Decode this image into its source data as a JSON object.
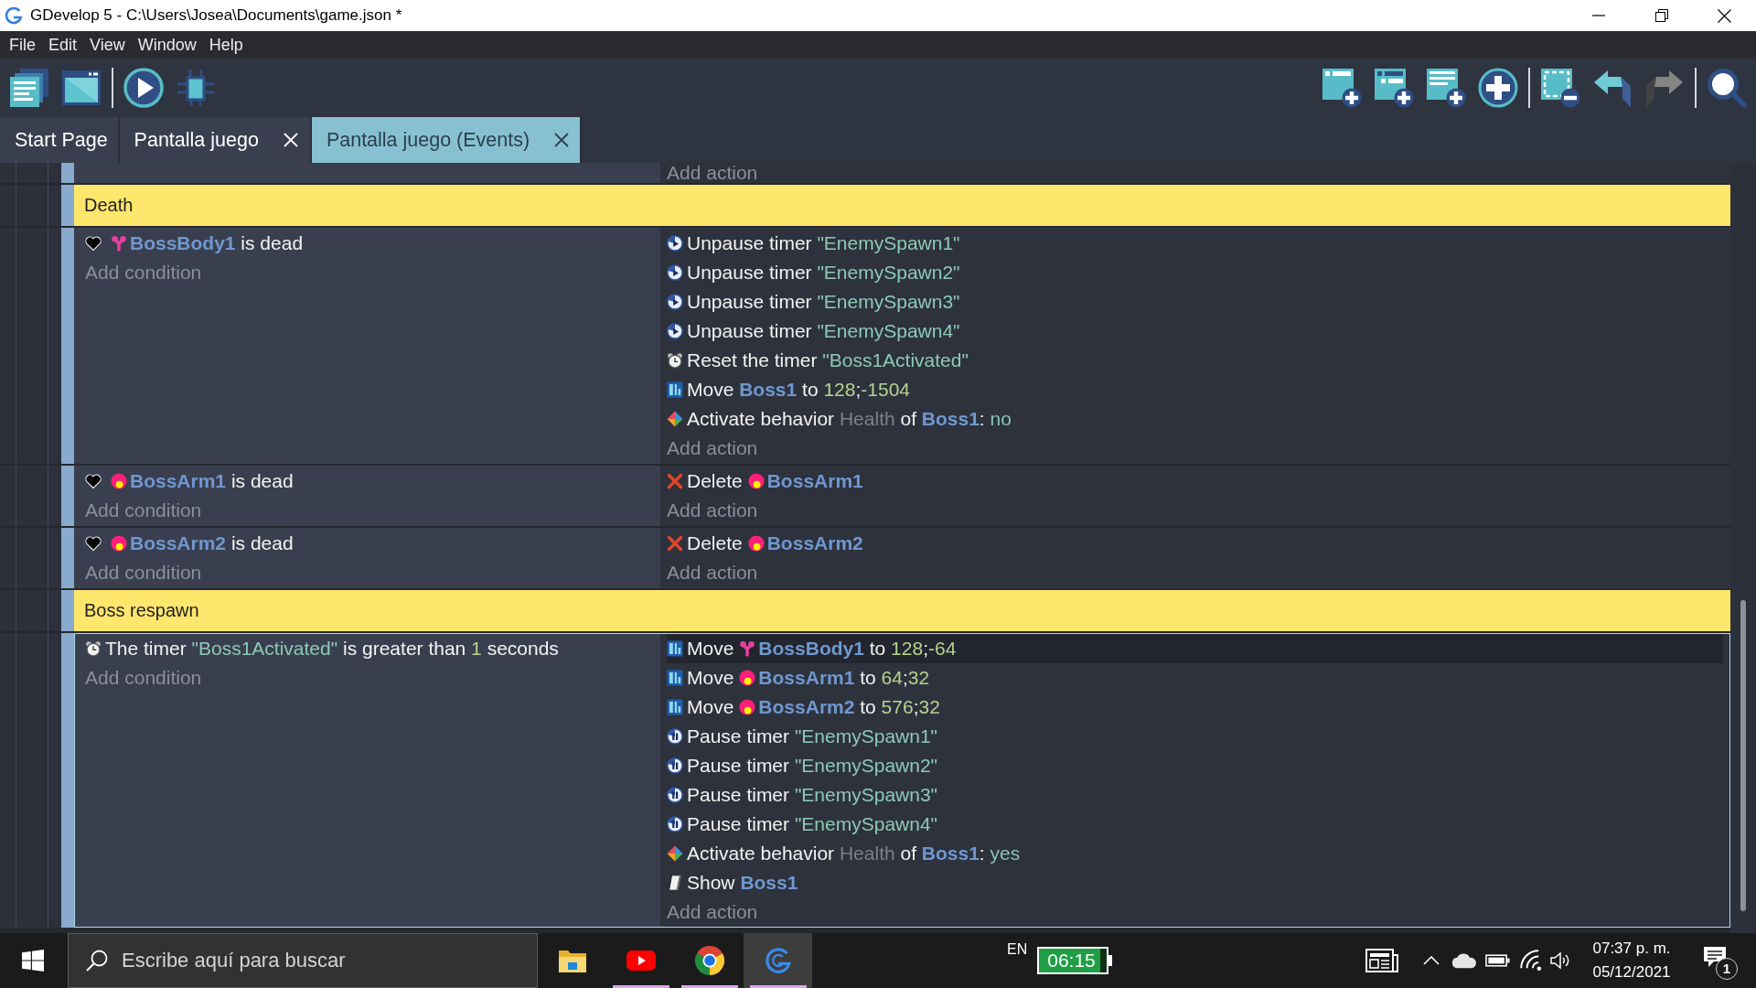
{
  "window": {
    "title": "GDevelop 5 - C:\\Users\\Josea\\Documents\\game.json *"
  },
  "menu": [
    "File",
    "Edit",
    "View",
    "Window",
    "Help"
  ],
  "toolbar": {
    "left": [
      [
        {
          "kind": "project",
          "disabled": false
        },
        {
          "kind": "scene",
          "disabled": false
        }
      ],
      [
        {
          "kind": "preview",
          "disabled": false
        },
        {
          "kind": "debugger",
          "disabled": false
        }
      ]
    ],
    "right": [
      [
        {
          "kind": "event",
          "disabled": false
        },
        {
          "kind": "subevent",
          "disabled": false
        },
        {
          "kind": "comment",
          "disabled": false
        },
        {
          "kind": "instruction",
          "disabled": false
        }
      ],
      [
        {
          "kind": "delete",
          "disabled": false
        },
        {
          "kind": "undo",
          "disabled": false
        },
        {
          "kind": "redo",
          "disabled": true
        }
      ],
      [
        {
          "kind": "search",
          "disabled": false
        }
      ]
    ]
  },
  "tabs": [
    {
      "label": "Start Page",
      "selected": false,
      "closable": false
    },
    {
      "label": "Pantalla juego",
      "selected": false,
      "closable": true
    },
    {
      "label": "Pantalla juego (Events)",
      "selected": true,
      "closable": true
    }
  ],
  "events": [
    {
      "kind": "standard",
      "selected": false,
      "add_action": "Add action"
    },
    {
      "kind": "comment",
      "selected": false,
      "text": "Death"
    },
    {
      "kind": "standard",
      "selected": false,
      "conditions": [
        {
          "kind": "dead",
          "hovered": false,
          "parts": [
            {
              "kind": "body",
              "text": "BossBody1"
            },
            {
              "kind": "text",
              "text": " is dead"
            }
          ]
        }
      ],
      "add_condition": "Add condition",
      "actions": [
        {
          "kind": "unpause",
          "hovered": false,
          "parts": [
            {
              "kind": "text",
              "text": "Unpause timer "
            },
            {
              "kind": "string",
              "text": "\"EnemySpawn1\""
            }
          ]
        },
        {
          "kind": "unpause",
          "hovered": false,
          "parts": [
            {
              "kind": "text",
              "text": "Unpause timer "
            },
            {
              "kind": "string",
              "text": "\"EnemySpawn2\""
            }
          ]
        },
        {
          "kind": "unpause",
          "hovered": false,
          "parts": [
            {
              "kind": "text",
              "text": "Unpause timer "
            },
            {
              "kind": "string",
              "text": "\"EnemySpawn3\""
            }
          ]
        },
        {
          "kind": "unpause",
          "hovered": false,
          "parts": [
            {
              "kind": "text",
              "text": "Unpause timer "
            },
            {
              "kind": "string",
              "text": "\"EnemySpawn4\""
            }
          ]
        },
        {
          "kind": "reset",
          "hovered": false,
          "parts": [
            {
              "kind": "text",
              "text": "Reset the timer "
            },
            {
              "kind": "string",
              "text": "\"Boss1Activated\""
            }
          ]
        },
        {
          "kind": "move",
          "hovered": false,
          "parts": [
            {
              "kind": "text",
              "text": "Move "
            },
            {
              "kind": "object",
              "text": "Boss1"
            },
            {
              "kind": "text",
              "text": " to "
            },
            {
              "kind": "number",
              "text": "128"
            },
            {
              "kind": "text",
              "text": ";"
            },
            {
              "kind": "number",
              "text": "-1504"
            }
          ]
        },
        {
          "kind": "behavior",
          "hovered": false,
          "parts": [
            {
              "kind": "text",
              "text": "Activate behavior "
            },
            {
              "kind": "param",
              "text": "Health"
            },
            {
              "kind": "text",
              "text": " of "
            },
            {
              "kind": "object",
              "text": "Boss1"
            },
            {
              "kind": "text",
              "text": ": "
            },
            {
              "kind": "value",
              "text": "no"
            }
          ]
        }
      ],
      "add_action": "Add action"
    },
    {
      "kind": "standard",
      "selected": false,
      "conditions": [
        {
          "kind": "dead",
          "hovered": false,
          "parts": [
            {
              "kind": "arm",
              "text": "BossArm1"
            },
            {
              "kind": "text",
              "text": " is dead"
            }
          ]
        }
      ],
      "add_condition": "Add condition",
      "actions": [
        {
          "kind": "delete",
          "hovered": false,
          "parts": [
            {
              "kind": "text",
              "text": "Delete"
            },
            {
              "kind": "arm",
              "text": "BossArm1"
            }
          ]
        }
      ],
      "add_action": "Add action"
    },
    {
      "kind": "standard",
      "selected": false,
      "conditions": [
        {
          "kind": "dead",
          "hovered": false,
          "parts": [
            {
              "kind": "arm",
              "text": "BossArm2"
            },
            {
              "kind": "text",
              "text": " is dead"
            }
          ]
        }
      ],
      "add_condition": "Add condition",
      "actions": [
        {
          "kind": "delete",
          "hovered": false,
          "parts": [
            {
              "kind": "text",
              "text": "Delete"
            },
            {
              "kind": "arm",
              "text": "BossArm2"
            }
          ]
        }
      ],
      "add_action": "Add action"
    },
    {
      "kind": "comment",
      "selected": false,
      "text": "Boss respawn"
    },
    {
      "kind": "standard",
      "selected": true,
      "conditions": [
        {
          "kind": "timer",
          "hovered": false,
          "parts": [
            {
              "kind": "text",
              "text": "The timer "
            },
            {
              "kind": "string",
              "text": "\"Boss1Activated\""
            },
            {
              "kind": "text",
              "text": " is greater than "
            },
            {
              "kind": "number",
              "text": "1"
            },
            {
              "kind": "text",
              "text": " seconds"
            }
          ]
        }
      ],
      "add_condition": "Add condition",
      "actions": [
        {
          "kind": "move",
          "hovered": true,
          "parts": [
            {
              "kind": "text",
              "text": "Move"
            },
            {
              "kind": "body",
              "text": "BossBody1"
            },
            {
              "kind": "text",
              "text": " to "
            },
            {
              "kind": "number",
              "text": "128"
            },
            {
              "kind": "text",
              "text": ";"
            },
            {
              "kind": "number",
              "text": "-64"
            }
          ]
        },
        {
          "kind": "move",
          "hovered": false,
          "parts": [
            {
              "kind": "text",
              "text": "Move"
            },
            {
              "kind": "arm",
              "text": "BossArm1"
            },
            {
              "kind": "text",
              "text": " to "
            },
            {
              "kind": "number",
              "text": "64"
            },
            {
              "kind": "text",
              "text": ";"
            },
            {
              "kind": "number",
              "text": "32"
            }
          ]
        },
        {
          "kind": "move",
          "hovered": false,
          "parts": [
            {
              "kind": "text",
              "text": "Move"
            },
            {
              "kind": "arm",
              "text": "BossArm2"
            },
            {
              "kind": "text",
              "text": " to "
            },
            {
              "kind": "number",
              "text": "576"
            },
            {
              "kind": "text",
              "text": ";"
            },
            {
              "kind": "number",
              "text": "32"
            }
          ]
        },
        {
          "kind": "pause",
          "hovered": false,
          "parts": [
            {
              "kind": "text",
              "text": "Pause timer "
            },
            {
              "kind": "string",
              "text": "\"EnemySpawn1\""
            }
          ]
        },
        {
          "kind": "pause",
          "hovered": false,
          "parts": [
            {
              "kind": "text",
              "text": "Pause timer "
            },
            {
              "kind": "string",
              "text": "\"EnemySpawn2\""
            }
          ]
        },
        {
          "kind": "pause",
          "hovered": false,
          "parts": [
            {
              "kind": "text",
              "text": "Pause timer "
            },
            {
              "kind": "string",
              "text": "\"EnemySpawn3\""
            }
          ]
        },
        {
          "kind": "pause",
          "hovered": false,
          "parts": [
            {
              "kind": "text",
              "text": "Pause timer "
            },
            {
              "kind": "string",
              "text": "\"EnemySpawn4\""
            }
          ]
        },
        {
          "kind": "behavior",
          "hovered": false,
          "parts": [
            {
              "kind": "text",
              "text": "Activate behavior "
            },
            {
              "kind": "param",
              "text": "Health"
            },
            {
              "kind": "text",
              "text": " of "
            },
            {
              "kind": "object",
              "text": "Boss1"
            },
            {
              "kind": "text",
              "text": ": "
            },
            {
              "kind": "value",
              "text": "yes"
            }
          ]
        },
        {
          "kind": "show",
          "hovered": false,
          "parts": [
            {
              "kind": "text",
              "text": "Show "
            },
            {
              "kind": "object",
              "text": "Boss1"
            }
          ]
        }
      ],
      "add_action": "Add action"
    }
  ],
  "taskbar": {
    "search": {
      "placeholder": "Escribe aquí para buscar"
    },
    "apps": [
      {
        "kind": "files",
        "running": false,
        "active": false
      },
      {
        "kind": "video",
        "running": true,
        "active": false
      },
      {
        "kind": "browser",
        "running": true,
        "active": false
      },
      {
        "kind": "editor",
        "running": true,
        "active": true
      }
    ],
    "language": "EN",
    "battery_time": "06:15",
    "clock": {
      "time": "07:37 p. m.",
      "date": "05/12/2021"
    },
    "notification_count": "1"
  }
}
